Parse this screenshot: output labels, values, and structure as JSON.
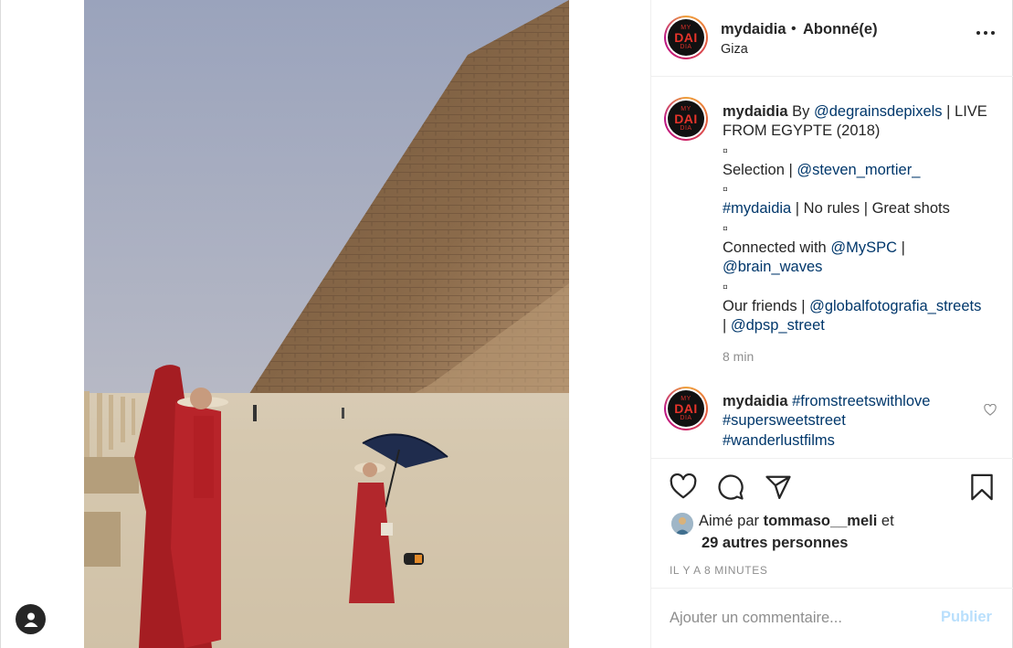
{
  "post": {
    "username": "mydaidia",
    "separator": "•",
    "follow_status": "Abonné(e)",
    "location": "Giza",
    "avatar_logo": {
      "line1": "MY",
      "line2": "DAI",
      "line3": "DIA"
    }
  },
  "caption": {
    "username": "mydaidia",
    "text_parts": [
      " By ",
      "@degrainsdepixels",
      " | LIVE FROM EGYPTE (2018)",
      "▫",
      "Selection | ",
      "@steven_mortier_",
      "▫",
      "#mydaidia",
      " | No rules | Great shots",
      "▫",
      "Connected with ",
      "@MySPC",
      " | ",
      "@brain_waves",
      "▫",
      "Our friends | ",
      "@globalfotografia_streets",
      " | ",
      "@dpsp_street"
    ],
    "time": "8 min"
  },
  "comment2": {
    "username": "mydaidia",
    "tags": [
      "#fromstreetswithlove",
      "#supersweetstreet",
      "#wanderlustfilms"
    ]
  },
  "actions": {
    "like_icon": "heart-icon",
    "comment_icon": "comment-icon",
    "share_icon": "paper-plane-icon",
    "save_icon": "bookmark-icon"
  },
  "likes": {
    "prefix": "Aimé par ",
    "user": "tommaso__meli",
    "suffix": " et",
    "others": "29 autres personnes"
  },
  "timestamp": "IL Y A 8 MINUTES",
  "comment_box": {
    "placeholder": "Ajouter un commentaire...",
    "publish_label": "Publier"
  },
  "colors": {
    "link": "#00376b",
    "muted": "#8e8e8e",
    "publish_disabled": "#b9dffc"
  }
}
